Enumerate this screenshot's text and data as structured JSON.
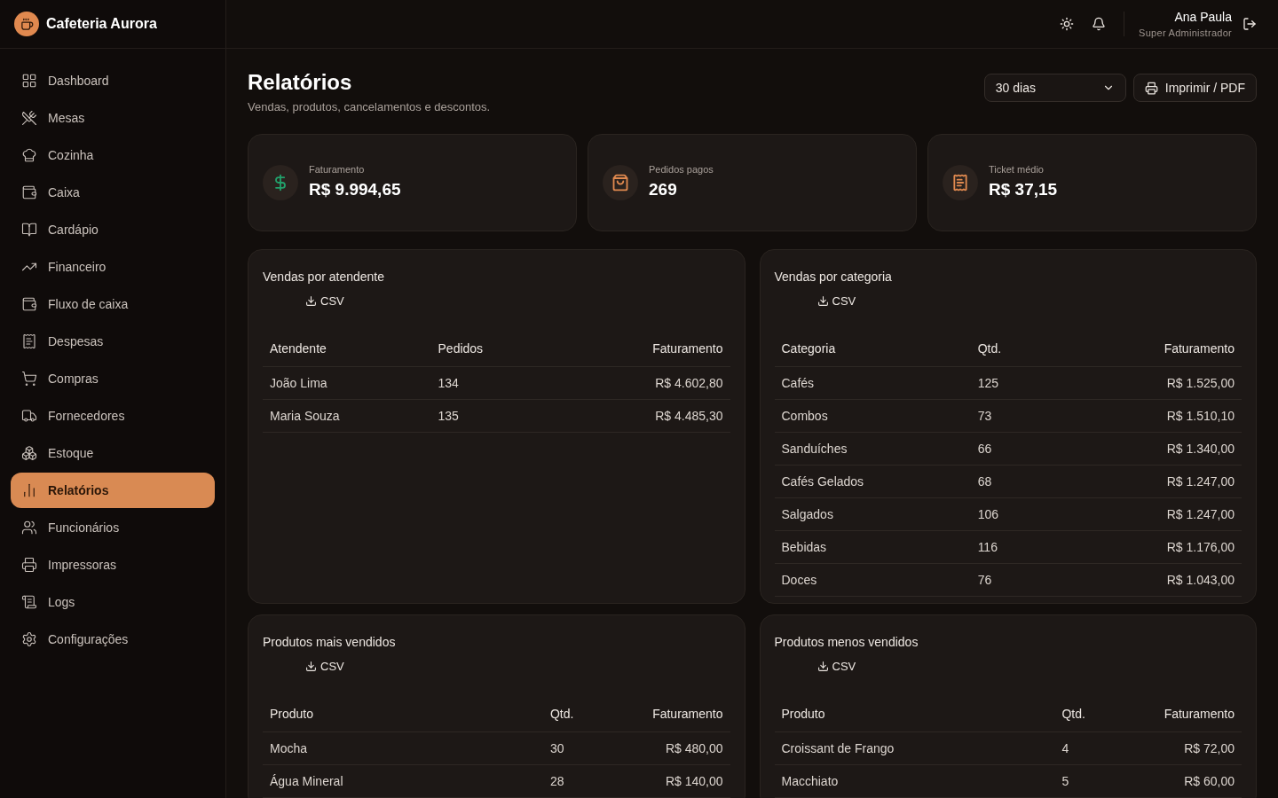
{
  "brand": {
    "name": "Cafeteria Aurora"
  },
  "sidebar": {
    "items": [
      {
        "label": "Dashboard",
        "selected": false
      },
      {
        "label": "Mesas",
        "selected": false
      },
      {
        "label": "Cozinha",
        "selected": false
      },
      {
        "label": "Caixa",
        "selected": false
      },
      {
        "label": "Cardápio",
        "selected": false
      },
      {
        "label": "Financeiro",
        "selected": false
      },
      {
        "label": "Fluxo de caixa",
        "selected": false
      },
      {
        "label": "Despesas",
        "selected": false
      },
      {
        "label": "Compras",
        "selected": false
      },
      {
        "label": "Fornecedores",
        "selected": false
      },
      {
        "label": "Estoque",
        "selected": false
      },
      {
        "label": "Relatórios",
        "selected": true
      },
      {
        "label": "Funcionários",
        "selected": false
      },
      {
        "label": "Impressoras",
        "selected": false
      },
      {
        "label": "Logs",
        "selected": false
      },
      {
        "label": "Configurações",
        "selected": false
      }
    ]
  },
  "user": {
    "name": "Ana Paula",
    "role": "Super Administrador"
  },
  "page": {
    "title": "Relatórios",
    "subtitle": "Vendas, produtos, cancelamentos e descontos.",
    "period": "30 dias",
    "print_button": "Imprimir / PDF"
  },
  "stats": [
    {
      "label": "Faturamento",
      "value": "R$ 9.994,65",
      "color": "#22a06b"
    },
    {
      "label": "Pedidos pagos",
      "value": "269",
      "color": "#e0894f"
    },
    {
      "label": "Ticket médio",
      "value": "R$ 37,15",
      "color": "#e0894f"
    }
  ],
  "tables": [
    {
      "title": "Vendas por atendente",
      "csv": "CSV",
      "columns": [
        "Atendente",
        "Pedidos",
        "Faturamento"
      ],
      "rows": [
        [
          "João Lima",
          "134",
          "R$ 4.602,80"
        ],
        [
          "Maria Souza",
          "135",
          "R$ 4.485,30"
        ]
      ]
    },
    {
      "title": "Vendas por categoria",
      "csv": "CSV",
      "columns": [
        "Categoria",
        "Qtd.",
        "Faturamento"
      ],
      "rows": [
        [
          "Cafés",
          "125",
          "R$ 1.525,00"
        ],
        [
          "Combos",
          "73",
          "R$ 1.510,10"
        ],
        [
          "Sanduíches",
          "66",
          "R$ 1.340,00"
        ],
        [
          "Cafés Gelados",
          "68",
          "R$ 1.247,00"
        ],
        [
          "Salgados",
          "106",
          "R$ 1.247,00"
        ],
        [
          "Bebidas",
          "116",
          "R$ 1.176,00"
        ],
        [
          "Doces",
          "76",
          "R$ 1.043,00"
        ]
      ]
    },
    {
      "title": "Produtos mais vendidos",
      "csv": "CSV",
      "columns": [
        "Produto",
        "Qtd.",
        "Faturamento"
      ],
      "rows": [
        [
          "Mocha",
          "30",
          "R$ 480,00"
        ],
        [
          "Água Mineral",
          "28",
          "R$ 140,00"
        ]
      ]
    },
    {
      "title": "Produtos menos vendidos",
      "csv": "CSV",
      "columns": [
        "Produto",
        "Qtd.",
        "Faturamento"
      ],
      "rows": [
        [
          "Croissant de Frango",
          "4",
          "R$ 72,00"
        ],
        [
          "Macchiato",
          "5",
          "R$ 60,00"
        ]
      ]
    }
  ]
}
